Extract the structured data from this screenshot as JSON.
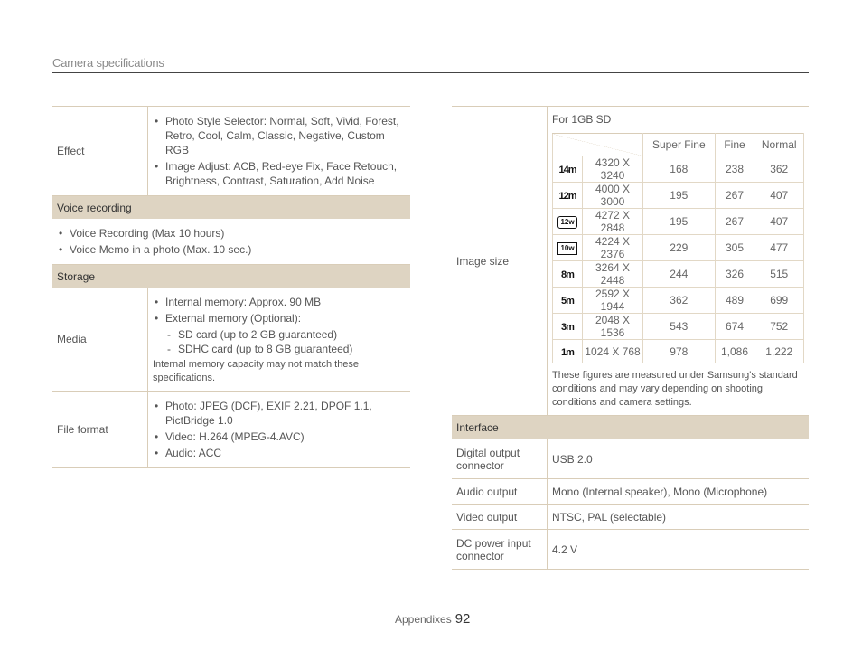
{
  "header": {
    "title": "Camera specifications"
  },
  "left": {
    "effect": {
      "label": "Effect",
      "items": [
        "Photo Style Selector: Normal, Soft, Vivid, Forest, Retro, Cool, Calm, Classic, Negative, Custom RGB",
        "Image Adjust: ACB, Red-eye Fix, Face Retouch, Brightness, Contrast, Saturation, Add Noise"
      ]
    },
    "voice": {
      "title": "Voice recording",
      "items": [
        "Voice Recording (Max 10 hours)",
        "Voice Memo in a photo (Max. 10 sec.)"
      ]
    },
    "storage": {
      "title": "Storage",
      "media_label": "Media",
      "media_items": [
        "Internal memory: Approx. 90 MB",
        "External memory (Optional):"
      ],
      "media_sub": [
        "SD card (up to 2 GB guaranteed)",
        "SDHC card (up to 8 GB guaranteed)"
      ],
      "media_note": "Internal memory capacity may not match these specifications.",
      "format_label": "File format",
      "format_items": [
        "Photo: JPEG (DCF), EXIF 2.21, DPOF 1.1, PictBridge 1.0",
        "Video: H.264 (MPEG-4.AVC)",
        "Audio: ACC"
      ]
    }
  },
  "right": {
    "image_size": {
      "label": "Image size",
      "caption": "For 1GB SD",
      "columns": [
        "Super Fine",
        "Fine",
        "Normal"
      ],
      "rows": [
        {
          "icon": "14m",
          "res": "4320 X 3240",
          "vals": [
            "168",
            "238",
            "362"
          ]
        },
        {
          "icon": "12m",
          "res": "4000 X 3000",
          "vals": [
            "195",
            "267",
            "407"
          ]
        },
        {
          "icon": "12w",
          "res": "4272 X 2848",
          "vals": [
            "195",
            "267",
            "407"
          ]
        },
        {
          "icon": "10w",
          "res": "4224 X 2376",
          "vals": [
            "229",
            "305",
            "477"
          ]
        },
        {
          "icon": "8m",
          "res": "3264 X 2448",
          "vals": [
            "244",
            "326",
            "515"
          ]
        },
        {
          "icon": "5m",
          "res": "2592 X 1944",
          "vals": [
            "362",
            "489",
            "699"
          ]
        },
        {
          "icon": "3m",
          "res": "2048 X 1536",
          "vals": [
            "543",
            "674",
            "752"
          ]
        },
        {
          "icon": "1m",
          "res": "1024 X 768",
          "vals": [
            "978",
            "1,086",
            "1,222"
          ]
        }
      ],
      "note": "These figures are measured under Samsung's standard conditions and may vary depending on shooting conditions and camera settings."
    },
    "interface": {
      "title": "Interface",
      "rows": [
        {
          "label": "Digital output connector",
          "value": "USB 2.0"
        },
        {
          "label": "Audio output",
          "value": "Mono (Internal speaker), Mono (Microphone)"
        },
        {
          "label": "Video output",
          "value": "NTSC, PAL (selectable)"
        },
        {
          "label": "DC power input connector",
          "value": "4.2 V"
        }
      ]
    }
  },
  "footer": {
    "section": "Appendixes",
    "page": "92"
  }
}
